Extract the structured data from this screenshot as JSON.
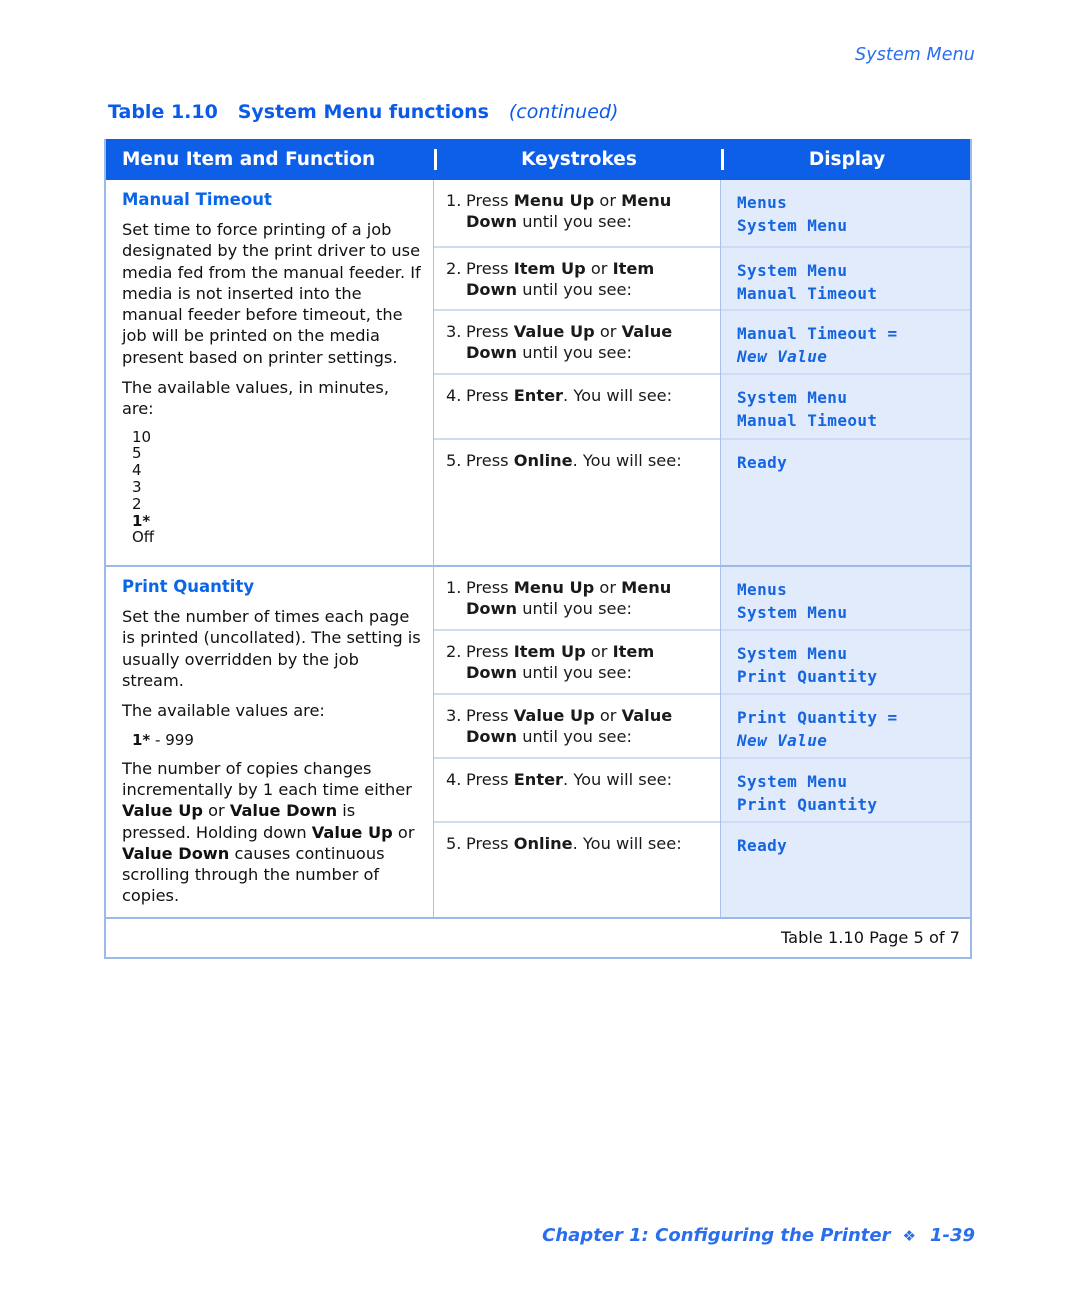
{
  "running_head": "System Menu",
  "table_title": {
    "label": "Table 1.10",
    "name": "System Menu functions",
    "continued": "(continued)"
  },
  "columns": {
    "menu_item": "Menu Item and Function",
    "keystrokes": "Keystrokes",
    "display": "Display"
  },
  "sections": [
    {
      "item_name": "Manual Timeout",
      "paragraphs": [
        "Set time to force printing of a job designated by the print driver to use media fed from the manual feeder. If media is not inserted into the manual feeder before timeout, the job will be printed on the media present based on printer settings.",
        "The available values, in minutes, are:"
      ],
      "values": [
        "10",
        "5",
        "4",
        "3",
        "2",
        "1*",
        "Off"
      ],
      "default_value": "1*",
      "steps": [
        {
          "num": "1.",
          "prefix": "Press ",
          "bold1": "Menu Up",
          "mid": " or ",
          "bold2": "Menu Down",
          "suffix": " until you see:"
        },
        {
          "num": "2.",
          "prefix": "Press ",
          "bold1": "Item Up",
          "mid": " or ",
          "bold2": "Item Down",
          "suffix": " until you see:"
        },
        {
          "num": "3.",
          "prefix": "Press ",
          "bold1": "Value Up",
          "mid": " or ",
          "bold2": "Value Down",
          "suffix": " until you see:"
        },
        {
          "num": "4.",
          "prefix": "Press ",
          "bold1": "Enter",
          "mid": "",
          "bold2": "",
          "suffix": ". You will see:"
        },
        {
          "num": "5.",
          "prefix": "Press ",
          "bold1": "Online",
          "mid": "",
          "bold2": "",
          "suffix": ". You will see:"
        }
      ],
      "displays": [
        {
          "line1": "Menus",
          "line2": "System Menu",
          "line2_italic": false
        },
        {
          "line1": "System Menu",
          "line2": "Manual Timeout",
          "line2_italic": false
        },
        {
          "line1": "Manual Timeout =",
          "line2": "New Value",
          "line2_italic": true
        },
        {
          "line1": "System Menu",
          "line2": "Manual Timeout",
          "line2_italic": false
        },
        {
          "line1": "Ready",
          "line2": "",
          "line2_italic": false
        }
      ]
    },
    {
      "item_name": "Print Quantity",
      "paragraphs": [
        "Set the number of times each page is printed (uncollated). The setting is usually overridden by the job stream.",
        "The available values are:"
      ],
      "value_range": "1* - 999",
      "value_range_default": "1*",
      "value_range_rest": " - 999",
      "trailing_paragraph_parts": [
        {
          "text": "The number of copies changes incrementally by 1 each time either ",
          "bold": false
        },
        {
          "text": "Value Up",
          "bold": true
        },
        {
          "text": " or ",
          "bold": false
        },
        {
          "text": "Value Down",
          "bold": true
        },
        {
          "text": " is pressed. Holding down ",
          "bold": false
        },
        {
          "text": "Value Up",
          "bold": true
        },
        {
          "text": " or ",
          "bold": false
        },
        {
          "text": "Value Down",
          "bold": true
        },
        {
          "text": " causes continuous scrolling through the number of copies.",
          "bold": false
        }
      ],
      "steps": [
        {
          "num": "1.",
          "prefix": "Press ",
          "bold1": "Menu Up",
          "mid": " or ",
          "bold2": "Menu Down",
          "suffix": " until you see:"
        },
        {
          "num": "2.",
          "prefix": "Press ",
          "bold1": "Item Up",
          "mid": " or ",
          "bold2": "Item Down",
          "suffix": " until you see:"
        },
        {
          "num": "3.",
          "prefix": "Press ",
          "bold1": "Value Up",
          "mid": " or ",
          "bold2": "Value Down",
          "suffix": " until you see:"
        },
        {
          "num": "4.",
          "prefix": "Press ",
          "bold1": "Enter",
          "mid": "",
          "bold2": "",
          "suffix": ". You will see:"
        },
        {
          "num": "5.",
          "prefix": "Press ",
          "bold1": "Online",
          "mid": "",
          "bold2": "",
          "suffix": ". You will see:"
        }
      ],
      "displays": [
        {
          "line1": "Menus",
          "line2": "System Menu",
          "line2_italic": false
        },
        {
          "line1": "System Menu",
          "line2": "Print Quantity",
          "line2_italic": false
        },
        {
          "line1": "Print Quantity =",
          "line2": "New Value",
          "line2_italic": true
        },
        {
          "line1": "System Menu",
          "line2": "Print Quantity",
          "line2_italic": false
        },
        {
          "line1": "Ready",
          "line2": "",
          "line2_italic": false
        }
      ]
    }
  ],
  "table_footer": "Table 1.10  Page 5 of 7",
  "page_footer": {
    "chapter": "Chapter 1: Configuring the Printer",
    "diamond": "❖",
    "page_number": "1-39"
  },
  "colors": {
    "header_blue": "#0d5fe8",
    "accent_blue": "#0a66e8",
    "display_bg": "#e2ebfb",
    "display_text": "#1565e0",
    "border": "#9cb9e8"
  }
}
